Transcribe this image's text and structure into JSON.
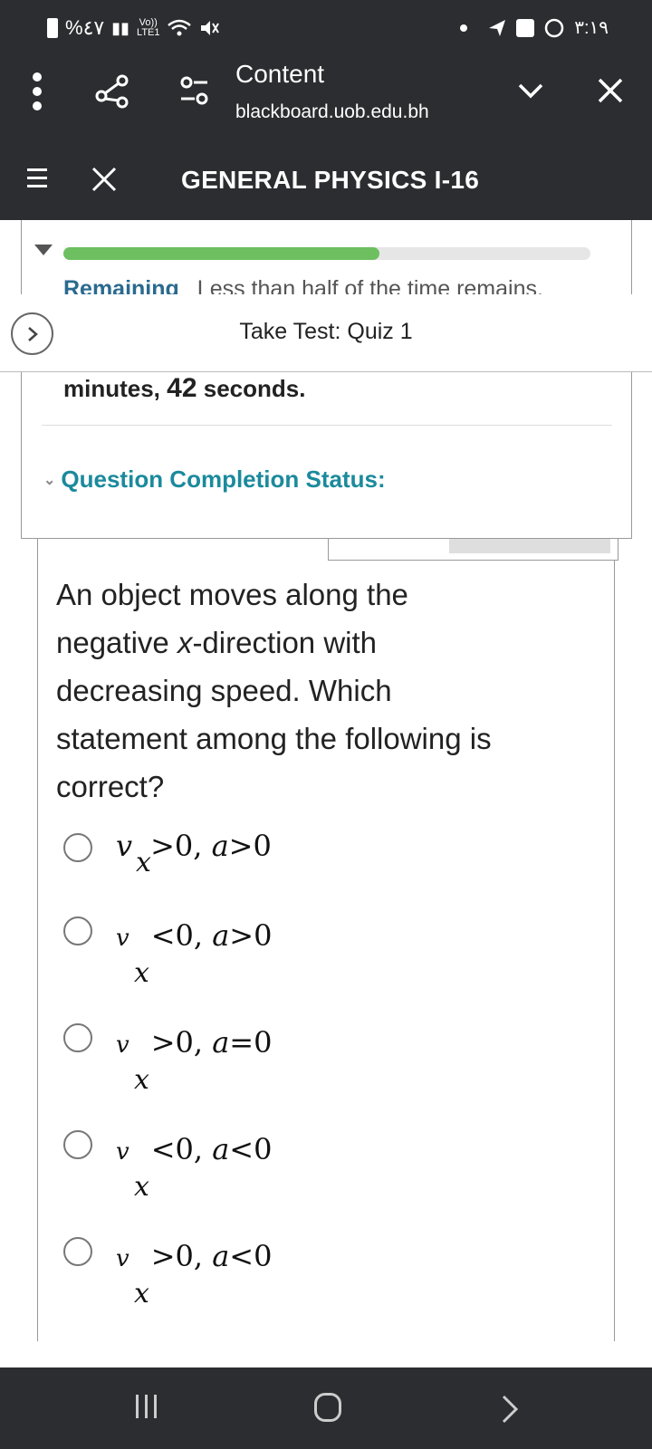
{
  "status_bar": {
    "battery_text": "%٤٧",
    "network_label": "Vo))",
    "lte_label": "LTE1",
    "time": "٣:١٩"
  },
  "browser": {
    "title": "Content",
    "url": "blackboard.uob.edu.bh"
  },
  "course": {
    "title": "GENERAL PHYSICS I-16"
  },
  "timer": {
    "progress": 0.6,
    "remaining_label": "Remaining",
    "remaining_message": "Less than half of the time remains.",
    "time_left_prefix": "minutes,",
    "seconds_value": "42",
    "seconds_suffix": "seconds."
  },
  "take_test": {
    "title": "Take Test: Quiz 1"
  },
  "completion": {
    "label": "Question Completion Status:"
  },
  "question": {
    "line1": "An object moves along the",
    "line2_pre": "negative ",
    "line2_var": "x",
    "line2_post": "-direction with",
    "line3": "decreasing speed. Which",
    "line4": "statement among the following is",
    "line5": "correct?",
    "options": [
      {
        "v": "v",
        "sub": "x",
        "rest1": ">0,",
        "a": "a",
        "rest2": ">0"
      },
      {
        "v": "v",
        "sub": "x",
        "rest1": "<0,",
        "a": "a",
        "rest2": ">0"
      },
      {
        "v": "v",
        "sub": "x",
        "rest1": ">0,",
        "a": "a",
        "rest2": "=0"
      },
      {
        "v": "v",
        "sub": "x",
        "rest1": "<0,",
        "a": "a",
        "rest2": "<0"
      },
      {
        "v": "v",
        "sub": "x",
        "rest1": ">0,",
        "a": "a",
        "rest2": "<0"
      }
    ]
  }
}
